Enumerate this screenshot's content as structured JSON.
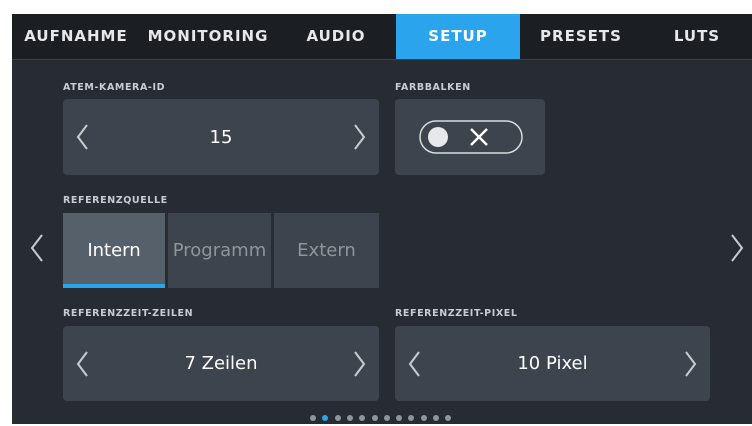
{
  "tabs": [
    {
      "label": "AUFNAHME",
      "active": false
    },
    {
      "label": "MONITORING",
      "active": false
    },
    {
      "label": "AUDIO",
      "active": false
    },
    {
      "label": "SETUP",
      "active": true
    },
    {
      "label": "PRESETS",
      "active": false
    },
    {
      "label": "LUTS",
      "active": false
    }
  ],
  "camera_id": {
    "label": "ATEM-KAMERA-ID",
    "value": "15"
  },
  "color_bars": {
    "label": "FARBBALKEN",
    "state": "off",
    "icon": "x-icon"
  },
  "reference_source": {
    "label": "REFERENZQUELLE",
    "options": [
      "Intern",
      "Programm",
      "Extern"
    ],
    "selected": "Intern"
  },
  "reference_lines": {
    "label": "REFERENZZEIT-ZEILEN",
    "value": "7 Zeilen"
  },
  "reference_pixels": {
    "label": "REFERENZZEIT-PIXEL",
    "value": "10 Pixel"
  },
  "pagination": {
    "total": 12,
    "current": 2
  },
  "colors": {
    "accent": "#2aa4ec",
    "background": "#272c33",
    "control": "#3d444d",
    "control_active": "#56606b"
  }
}
